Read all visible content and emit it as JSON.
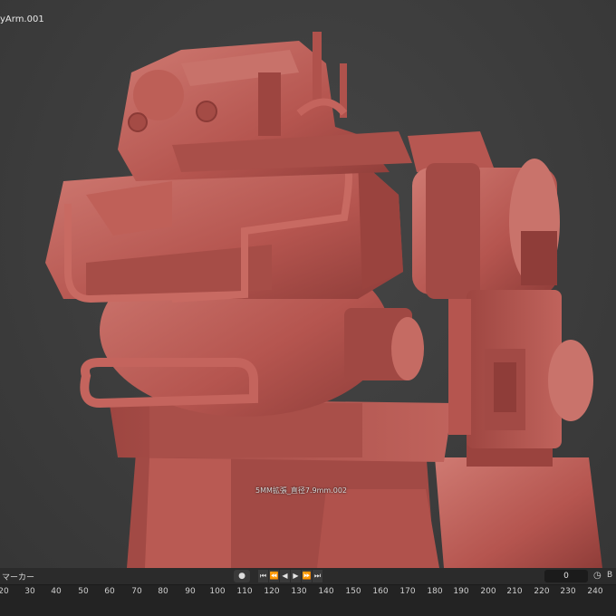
{
  "viewport": {
    "object_name": "yArm.001",
    "measurement_text": "5MM拡張_直径7.9mm.002"
  },
  "timeline": {
    "marker_menu": "マーカー",
    "keyframe_icon": "●",
    "playback_buttons": [
      "⏮",
      "⏪",
      "◀",
      "▶",
      "⏩",
      "⏭"
    ],
    "current_frame": "0",
    "clock_icon": "◷",
    "end_label": "B",
    "ruler_ticks": [
      "20",
      "30",
      "40",
      "50",
      "60",
      "70",
      "80",
      "90",
      "100",
      "110",
      "120",
      "130",
      "140",
      "150",
      "160",
      "170",
      "180",
      "190",
      "200",
      "210",
      "220",
      "230",
      "240"
    ]
  },
  "colors": {
    "model": "#b5554f",
    "model_dark": "#8f3d39",
    "model_light": "#cf7a72",
    "accent_blue": "#3f6fb5"
  }
}
